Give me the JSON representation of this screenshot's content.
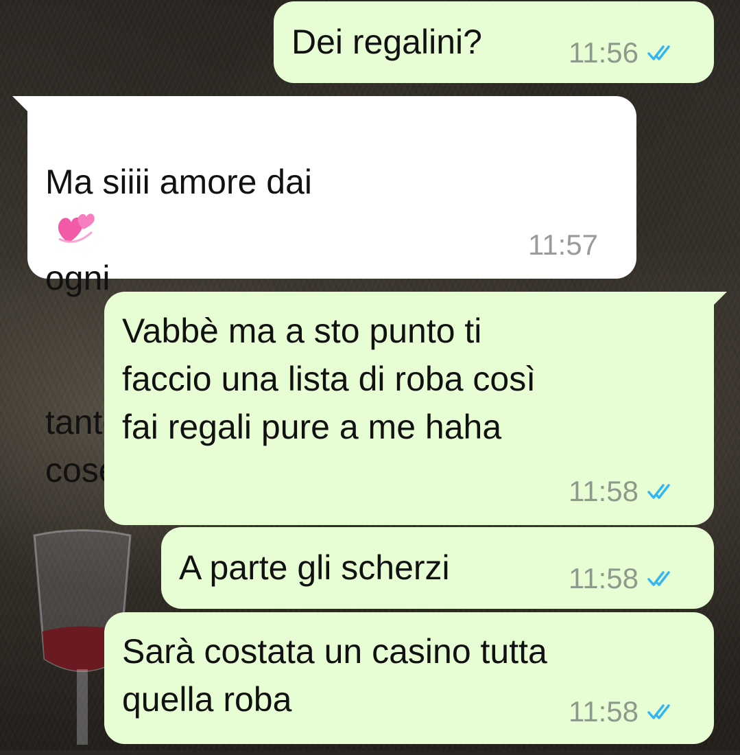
{
  "messages": [
    {
      "direction": "out",
      "text": "Dei regalini?",
      "time": "11:56",
      "status_icon": "read-double-check-icon"
    },
    {
      "direction": "in",
      "text_before_emoji": "Ma siiii amore dai",
      "emoji": "revolving-hearts-emoji",
      "text_after_emoji": "ogni",
      "text_rest": "tanto mi piace regalarmi delle\ncose",
      "time": "11:57"
    },
    {
      "direction": "out",
      "text": "Vabbè ma a sto punto ti\nfaccio una lista di roba così\nfai regali pure a me haha",
      "time": "11:58",
      "status_icon": "read-double-check-icon"
    },
    {
      "direction": "out",
      "text": "A parte gli scherzi",
      "time": "11:58",
      "status_icon": "read-double-check-icon"
    },
    {
      "direction": "out",
      "text": "Sarà costata un casino tutta\nquella roba",
      "time": "11:58",
      "status_icon": "read-double-check-icon"
    }
  ],
  "colors": {
    "outgoing_bubble": "#e7fdd4",
    "incoming_bubble": "#ffffff",
    "read_ticks": "#34b7f1"
  }
}
